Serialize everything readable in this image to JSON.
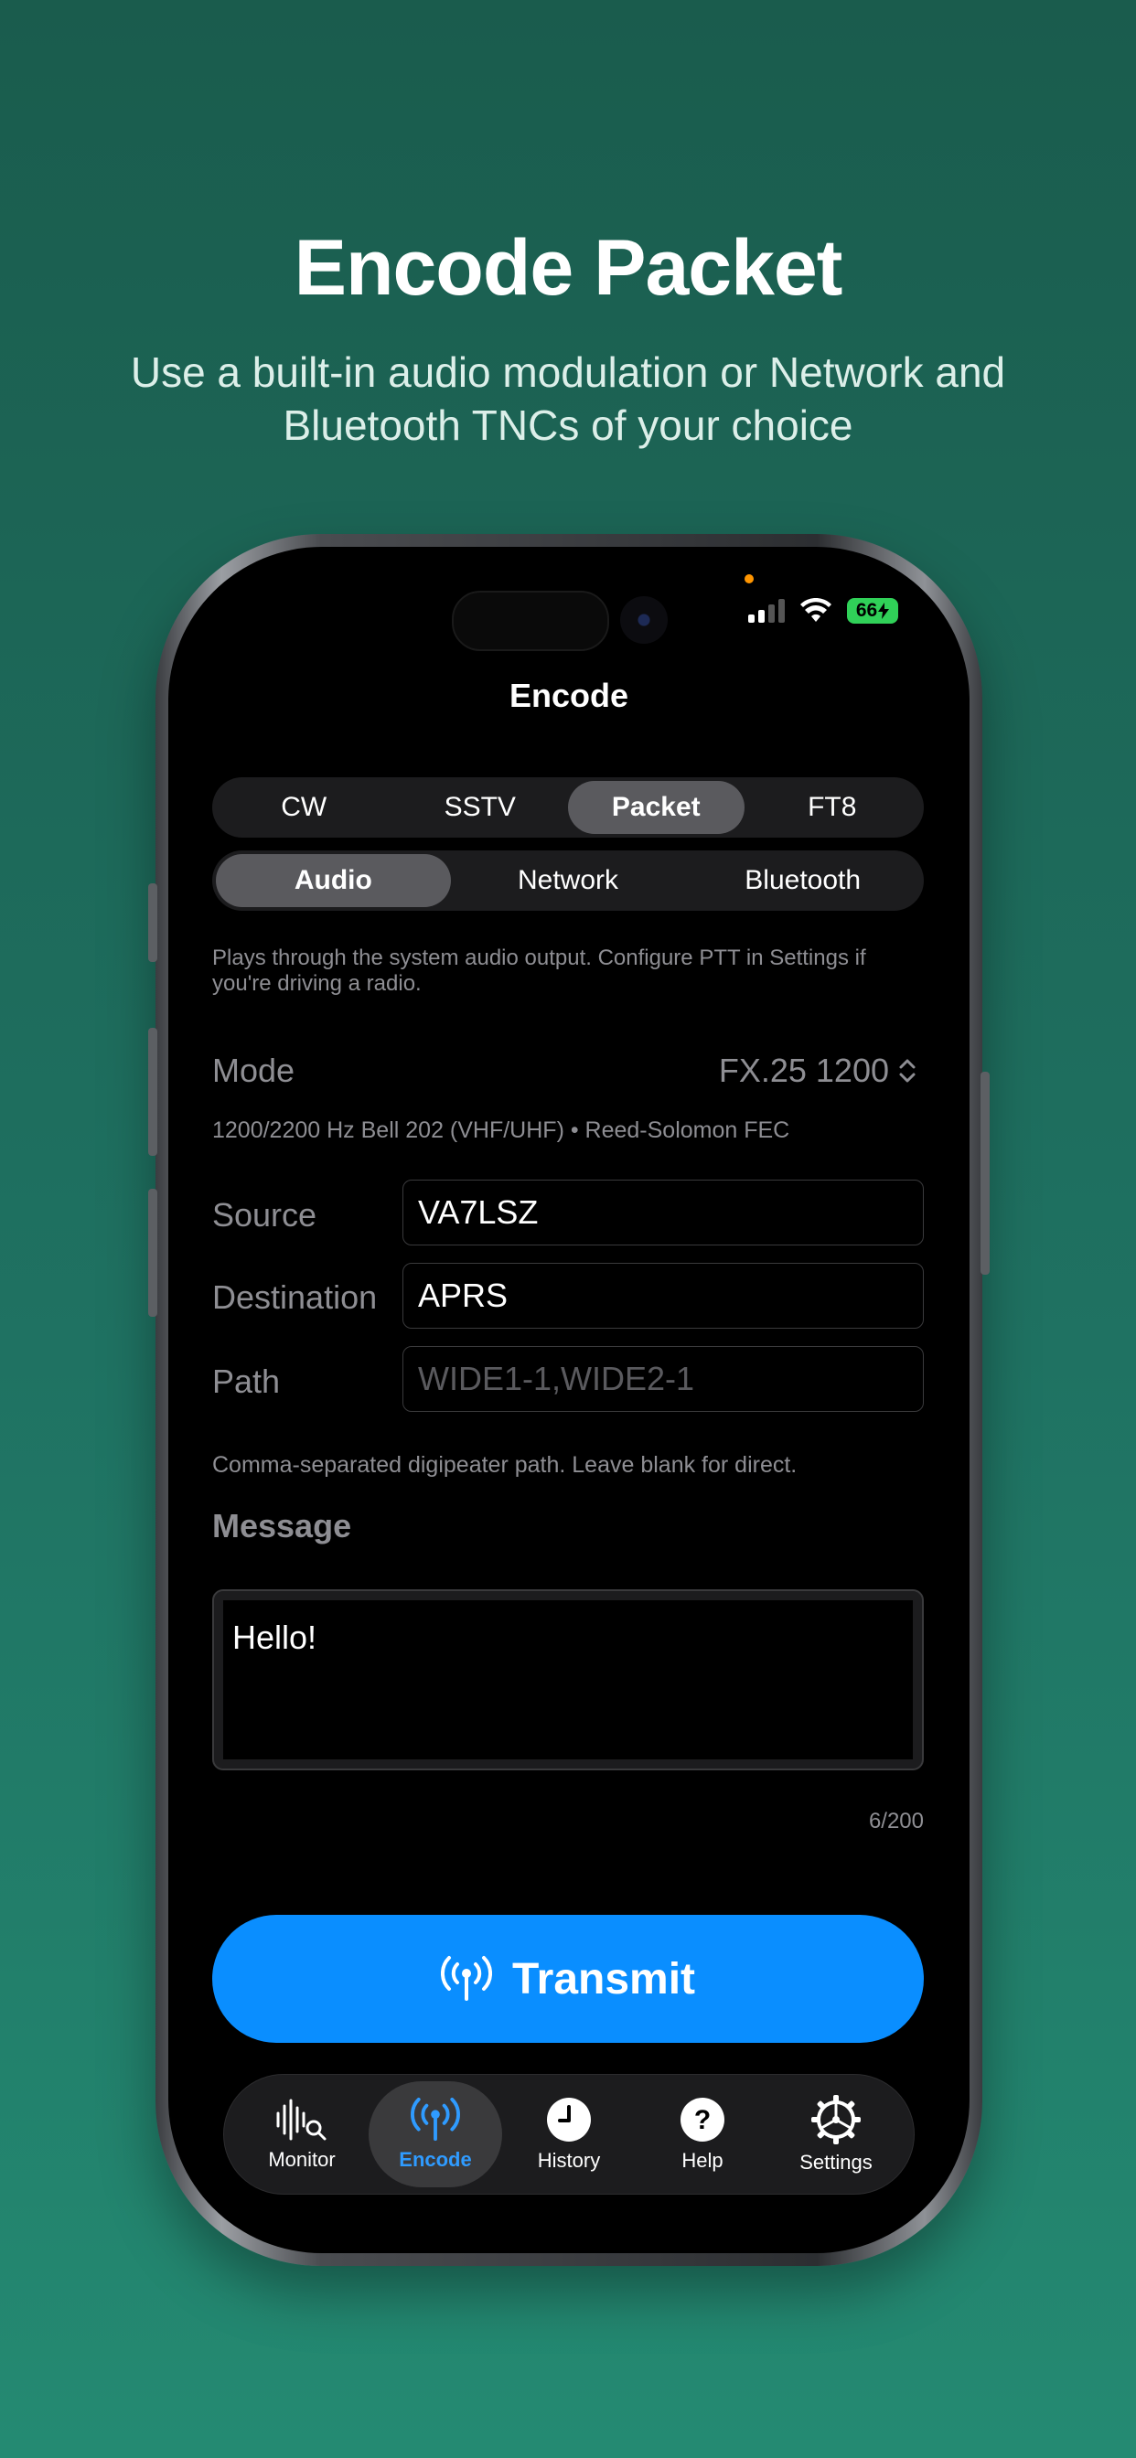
{
  "promo": {
    "title": "Encode Packet",
    "subtitle": "Use a built-in audio modulation or Network and Bluetooth TNCs of your choice"
  },
  "status_bar": {
    "battery": "66"
  },
  "nav": {
    "title": "Encode"
  },
  "mode_tabs": {
    "items": [
      "CW",
      "SSTV",
      "Packet",
      "FT8"
    ],
    "selected": "Packet"
  },
  "transport_tabs": {
    "items": [
      "Audio",
      "Network",
      "Bluetooth"
    ],
    "selected": "Audio"
  },
  "transport_hint": "Plays through the system audio output. Configure PTT in Settings if you're driving a radio.",
  "mode_row": {
    "label": "Mode",
    "value": "FX.25 1200",
    "description": "1200/2200 Hz Bell 202 (VHF/UHF) • Reed-Solomon FEC"
  },
  "fields": {
    "source": {
      "label": "Source",
      "value": "VA7LSZ"
    },
    "destination": {
      "label": "Destination",
      "value": "APRS"
    },
    "path": {
      "label": "Path",
      "placeholder": "WIDE1-1,WIDE2-1"
    }
  },
  "path_hint": "Comma-separated digipeater path. Leave blank for direct.",
  "message": {
    "label": "Message",
    "value": "Hello!",
    "counter": "6/200"
  },
  "transmit_label": "Transmit",
  "tabbar": {
    "items": [
      {
        "label": "Monitor",
        "icon": "waveform-search-icon"
      },
      {
        "label": "Encode",
        "icon": "antenna-icon"
      },
      {
        "label": "History",
        "icon": "clock-icon"
      },
      {
        "label": "Help",
        "icon": "question-icon"
      },
      {
        "label": "Settings",
        "icon": "gear-icon"
      }
    ],
    "selected": "Encode"
  },
  "colors": {
    "accent": "#0a8eff",
    "active_tab": "#2f9bff",
    "background_top": "#1a5c4d",
    "background_bottom": "#248a72"
  }
}
